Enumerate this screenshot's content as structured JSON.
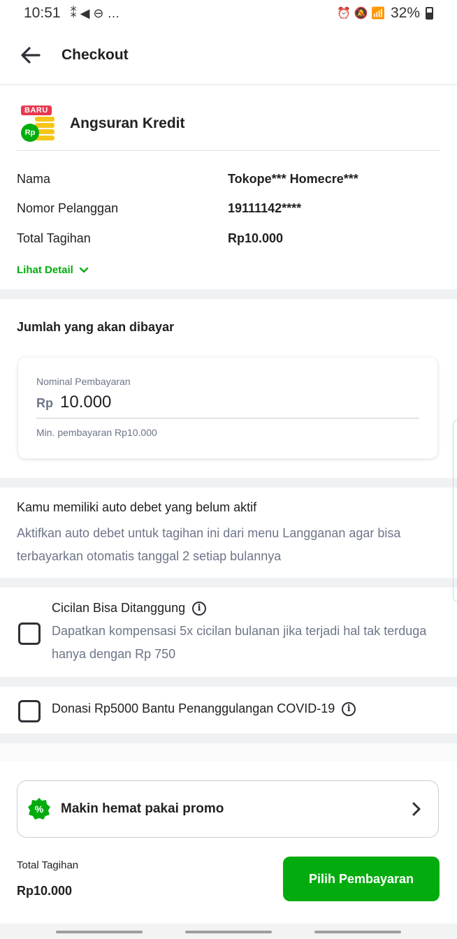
{
  "status_bar": {
    "time": "10:51",
    "left_icons": "⁑ ◀ ⊖ …",
    "right_icons": "⏰ 🔕 📶",
    "battery": "32%"
  },
  "header": {
    "title": "Checkout"
  },
  "product": {
    "badge": "BARU",
    "logo_text": "Rp",
    "name": "Angsuran Kredit"
  },
  "bill": {
    "rows": [
      {
        "label": "Nama",
        "value": "Tokope*** Homecre***"
      },
      {
        "label": "Nomor Pelanggan",
        "value": "19111142****"
      },
      {
        "label": "Total Tagihan",
        "value": "Rp10.000"
      }
    ],
    "detail_link": "Lihat Detail"
  },
  "payment": {
    "section_title": "Jumlah yang akan dibayar",
    "field_label": "Nominal Pembayaran",
    "prefix": "Rp",
    "value": "10.000",
    "hint": "Min. pembayaran Rp10.000"
  },
  "autodebet": {
    "title": "Kamu memiliki auto debet yang belum aktif",
    "description": "Aktifkan auto debet untuk tagihan ini dari menu Langganan agar bisa terbayarkan otomatis tanggal 2 setiap bulannya"
  },
  "insurance": {
    "title": "Cicilan Bisa Ditanggung",
    "description": "Dapatkan kompensasi 5x cicilan bulanan jika terjadi hal tak terduga hanya dengan Rp 750",
    "checked": false
  },
  "donation": {
    "label": "Donasi Rp5000 Bantu Penanggulangan COVID-19",
    "checked": false
  },
  "promo": {
    "label": "Makin hemat pakai promo",
    "icon": "%"
  },
  "footer": {
    "total_label": "Total Tagihan",
    "total_value": "Rp10.000",
    "button_label": "Pilih Pembayaran"
  },
  "colors": {
    "primary": "#03ac0e",
    "badge": "#e8384f",
    "text": "#212121",
    "muted": "#6d7588"
  }
}
